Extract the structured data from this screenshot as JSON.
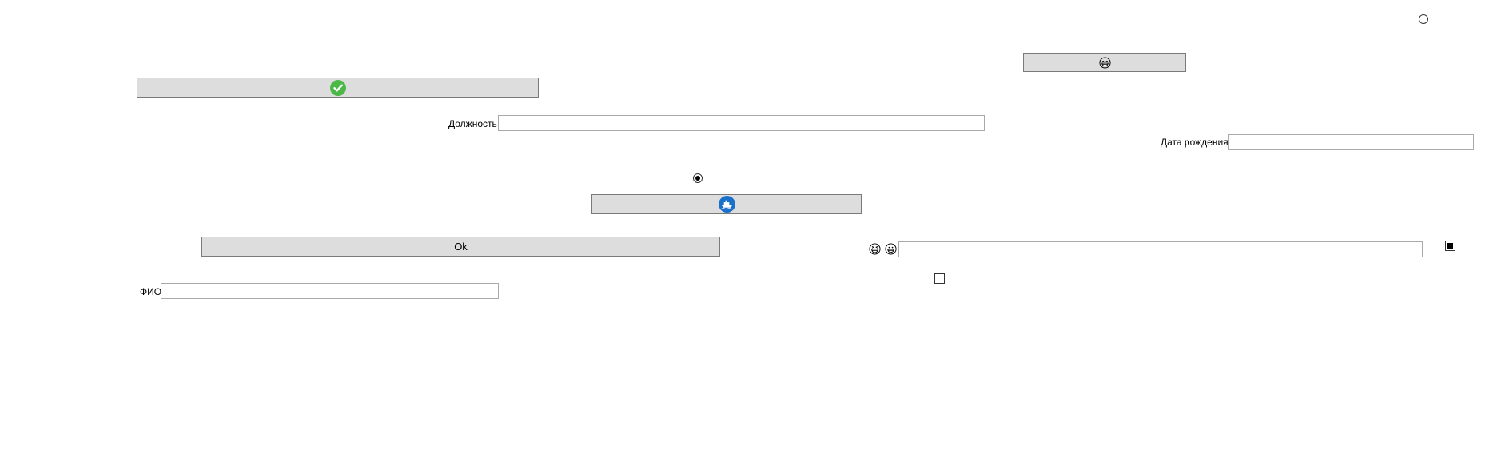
{
  "form": {
    "ok_button_label": "Ok",
    "labels": {
      "position": "Должность",
      "birth_date": "Дата рождения",
      "full_name": "ФИО"
    },
    "fields": {
      "position": "",
      "birth_date": "",
      "full_name": "",
      "emoji_field": ""
    },
    "radios": {
      "top_right": false,
      "middle": true
    },
    "checkboxes": {
      "right": true,
      "middle": false
    },
    "icons": {
      "check_button": "check-circle-icon",
      "emoji_button": "grinning-face-icon",
      "ship_button": "ship-badge-icon",
      "emoji_pair": [
        "laughing-face-icon",
        "grinning-face-icon"
      ]
    },
    "colors": {
      "button_bg": "#dddddd",
      "check_green": "#4cb848",
      "ship_blue": "#1a6fc9"
    }
  }
}
